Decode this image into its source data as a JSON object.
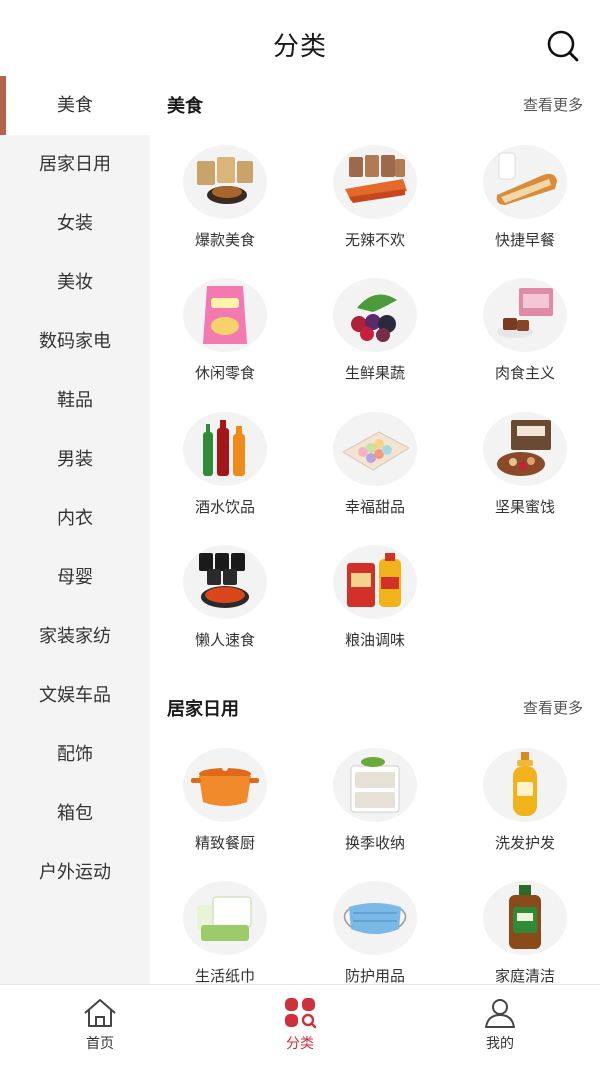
{
  "header": {
    "title": "分类"
  },
  "sidebar": {
    "active_index": 0,
    "items": [
      {
        "label": "美食"
      },
      {
        "label": "居家日用"
      },
      {
        "label": "女装"
      },
      {
        "label": "美妆"
      },
      {
        "label": "数码家电"
      },
      {
        "label": "鞋品"
      },
      {
        "label": "男装"
      },
      {
        "label": "内衣"
      },
      {
        "label": "母婴"
      },
      {
        "label": "家装家纺"
      },
      {
        "label": "文娱车品"
      },
      {
        "label": "配饰"
      },
      {
        "label": "箱包"
      },
      {
        "label": "户外运动"
      }
    ]
  },
  "sections": [
    {
      "title": "美食",
      "more": "查看更多",
      "items": [
        {
          "label": "爆款美食",
          "icon": "snack-bags-icon"
        },
        {
          "label": "无辣不欢",
          "icon": "spicy-meat-icon"
        },
        {
          "label": "快捷早餐",
          "icon": "bread-milk-icon"
        },
        {
          "label": "休闲零食",
          "icon": "chips-bag-icon"
        },
        {
          "label": "生鲜果蔬",
          "icon": "berries-icon"
        },
        {
          "label": "肉食主义",
          "icon": "meat-gift-box-icon"
        },
        {
          "label": "酒水饮品",
          "icon": "bottles-icon"
        },
        {
          "label": "幸福甜品",
          "icon": "macarons-icon"
        },
        {
          "label": "坚果蜜饯",
          "icon": "nuts-box-icon"
        },
        {
          "label": "懒人速食",
          "icon": "instant-noodles-icon"
        },
        {
          "label": "粮油调味",
          "icon": "rice-oil-icon"
        }
      ]
    },
    {
      "title": "居家日用",
      "more": "查看更多",
      "items": [
        {
          "label": "精致餐厨",
          "icon": "cooking-pot-icon"
        },
        {
          "label": "换季收纳",
          "icon": "storage-drawer-icon"
        },
        {
          "label": "洗发护发",
          "icon": "shampoo-bottle-icon"
        },
        {
          "label": "生活纸巾",
          "icon": "tissue-pack-icon"
        },
        {
          "label": "防护用品",
          "icon": "face-mask-icon"
        },
        {
          "label": "家庭清洁",
          "icon": "disinfectant-bottle-icon"
        }
      ]
    }
  ],
  "tabbar": [
    {
      "label": "首页",
      "icon": "home-icon"
    },
    {
      "label": "分类",
      "icon": "category-icon"
    },
    {
      "label": "我的",
      "icon": "user-icon"
    }
  ],
  "colors": {
    "accent": "#d0303a",
    "sidebar_active_bar": "#b5634b",
    "sidebar_bg": "#f4f4f4"
  }
}
